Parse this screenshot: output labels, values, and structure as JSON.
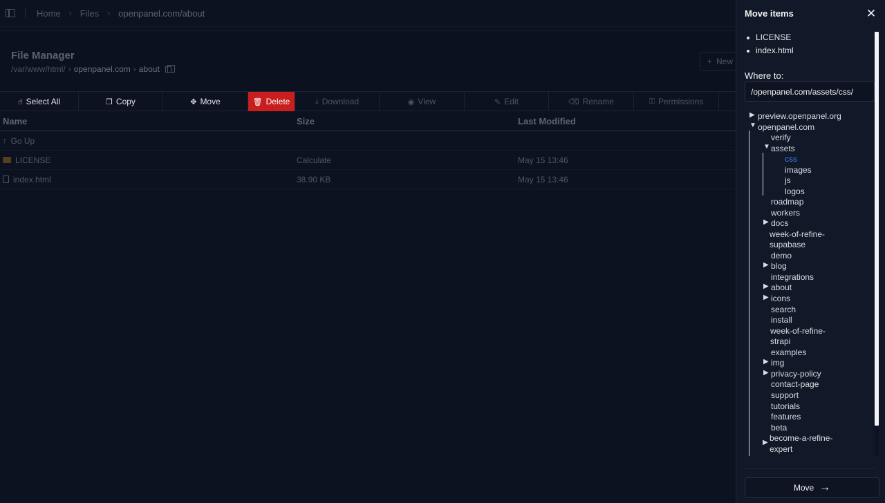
{
  "breadcrumbs": [
    "Home",
    "Files",
    "openpanel.com/about"
  ],
  "header": {
    "title": "File Manager",
    "path_root": "/var/www/html/",
    "path_seg1": "openpanel.com",
    "path_seg2": "about",
    "new_label": "New"
  },
  "toolbar": {
    "select_all": "Select All",
    "copy": "Copy",
    "move": "Move",
    "delete": "Delete",
    "download": "Download",
    "view": "View",
    "edit": "Edit",
    "rename": "Rename",
    "permissions": "Permissions"
  },
  "table": {
    "columns": [
      "Name",
      "Size",
      "Last Modified"
    ],
    "go_up": "Go Up",
    "rows": [
      {
        "name": "LICENSE",
        "size": "Calculate",
        "modified": "May 15 13:46",
        "icon": "folder-icon"
      },
      {
        "name": "index.html",
        "size": "38.90 KB",
        "modified": "May 15 13:46",
        "icon": "file-icon"
      }
    ]
  },
  "drawer": {
    "title": "Move items",
    "items": [
      "LICENSE",
      "index.html"
    ],
    "where_label": "Where to:",
    "destination": "/openpanel.com/assets/css/",
    "move_label": "Move",
    "tree": {
      "preview": "preview.openpanel.org",
      "openpanel": "openpanel.com",
      "verify": "verify",
      "assets": "assets",
      "css": "css",
      "images": "images",
      "js": "js",
      "logos": "logos",
      "roadmap": "roadmap",
      "workers": "workers",
      "docs": "docs",
      "wor_supabase_1": "week-of-refine-",
      "wor_supabase_2": "supabase",
      "demo": "demo",
      "blog": "blog",
      "integrations": "integrations",
      "about": "about",
      "icons": "icons",
      "search": "search",
      "install": "install",
      "wor_strapi_1": "week-of-refine-",
      "wor_strapi_2": "strapi",
      "examples": "examples",
      "img": "img",
      "privacy": "privacy-policy",
      "contact": "contact-page",
      "support": "support",
      "tutorials": "tutorials",
      "features": "features",
      "beta": "beta",
      "become_1": "become-a-refine-",
      "become_2": "expert"
    }
  }
}
